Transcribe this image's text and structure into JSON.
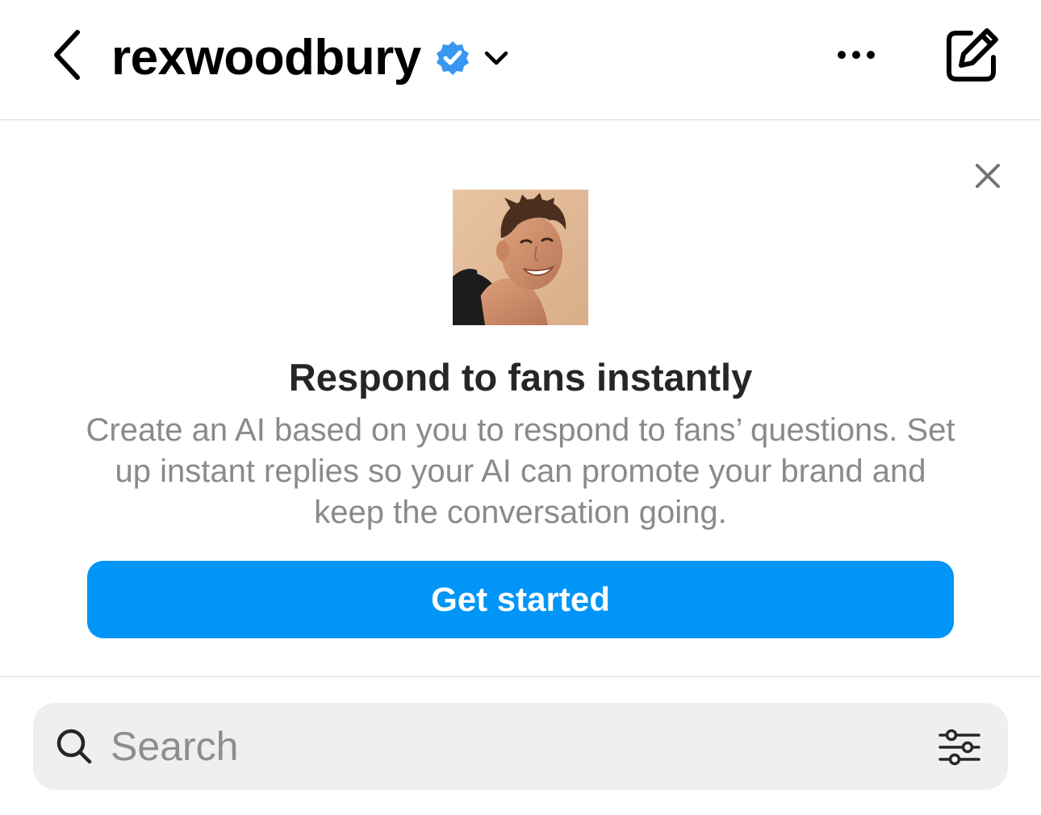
{
  "header": {
    "username": "rexwoodbury",
    "verified": true,
    "back_icon": "chevron-left-icon",
    "dropdown_icon": "chevron-down-icon",
    "more_icon": "more-horizontal-icon",
    "compose_icon": "compose-icon"
  },
  "promo": {
    "title": "Respond to fans instantly",
    "description": "Create an AI based on you to respond to fans’ questions. Set up instant replies so your AI can promote your brand and keep the conversation going.",
    "button_label": "Get started",
    "close_icon": "close-icon",
    "avatar_icon": "profile-photo"
  },
  "search": {
    "placeholder": "Search",
    "value": "",
    "search_icon": "search-icon",
    "filter_icon": "filter-sliders-icon"
  },
  "colors": {
    "accent": "#0095f6",
    "verified_badge": "#3897f0",
    "text_secondary": "#8a8a8a",
    "search_bg": "#efefef",
    "divider": "#dbdbdb"
  }
}
